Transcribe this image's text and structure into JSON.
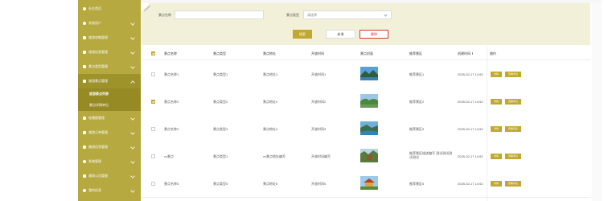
{
  "sidebar": {
    "items": [
      {
        "label": "社交首页",
        "icon": "home-icon"
      },
      {
        "label": "系统用户",
        "icon": "user-icon"
      },
      {
        "label": "旅游攻略管理",
        "icon": "grid-icon"
      },
      {
        "label": "旅游信息管理",
        "icon": "grid-icon"
      },
      {
        "label": "景点类型管理",
        "icon": "grid-icon"
      },
      {
        "label": "旅游景点管理",
        "icon": "grid-icon"
      },
      {
        "label": "旅游景点列表",
        "icon": ""
      },
      {
        "label": "景点详情单位",
        "icon": ""
      },
      {
        "label": "轮播图管理",
        "icon": "grid-icon"
      },
      {
        "label": "旅游订单管理",
        "icon": "grid-icon"
      },
      {
        "label": "路线信息管理",
        "icon": "grid-icon"
      },
      {
        "label": "系统管理",
        "icon": "gear-icon"
      },
      {
        "label": "通知公告管理",
        "icon": "doc-icon"
      },
      {
        "label": "我的信息",
        "icon": "gear-icon"
      }
    ]
  },
  "search": {
    "name_label": "景点名称",
    "name_placeholder": "",
    "type_label": "景点类型",
    "type_placeholder": "请选择",
    "search_btn": "搜索",
    "add_btn": "新增",
    "delete_btn": "删除"
  },
  "table": {
    "headers": [
      "景点名称",
      "景点类型",
      "景点地址",
      "开放时间",
      "景点封面",
      "推荐景区",
      "创建时间",
      "操作"
    ],
    "rows": [
      {
        "name": "景点名称1",
        "type": "景点类型1",
        "addr": "景点地址1",
        "open": "开放时间1",
        "rec": "推荐景区1",
        "created": "2025-02-17 14:52",
        "checked": false,
        "cover": "mountain-lake"
      },
      {
        "name": "景点名称2",
        "type": "景点类型2",
        "addr": "景点地址2",
        "open": "开放时间2",
        "rec": "推荐景区2",
        "created": "2025-02-17 14:52",
        "checked": true,
        "cover": "green-hills"
      },
      {
        "name": "景点名称3",
        "type": "景点类型3",
        "addr": "景点地址3",
        "open": "开放时间3",
        "rec": "推荐景区3",
        "created": "2025-02-17 14:52",
        "checked": false,
        "cover": "river-valley"
      },
      {
        "name": "xx景点",
        "type": "景点类型1",
        "addr": "xx景点地址编写",
        "open": "开放时间编写",
        "rec": "推荐景区描述编写 测试测试测试测试",
        "created": "2025-02-17 14:52",
        "checked": false,
        "cover": "forest-temple"
      },
      {
        "name": "景点名称5",
        "type": "景点类型5",
        "addr": "景点地址5",
        "open": "开放时间5",
        "rec": "推荐景区5",
        "created": "2025-02-17 14:52",
        "checked": false,
        "cover": "temple"
      }
    ],
    "detail_btn": "详情",
    "comment_btn": "查看评论"
  },
  "colors": {
    "accent": "#c1a830",
    "sidebar": "#b5a940",
    "danger": "#d23b2c"
  }
}
